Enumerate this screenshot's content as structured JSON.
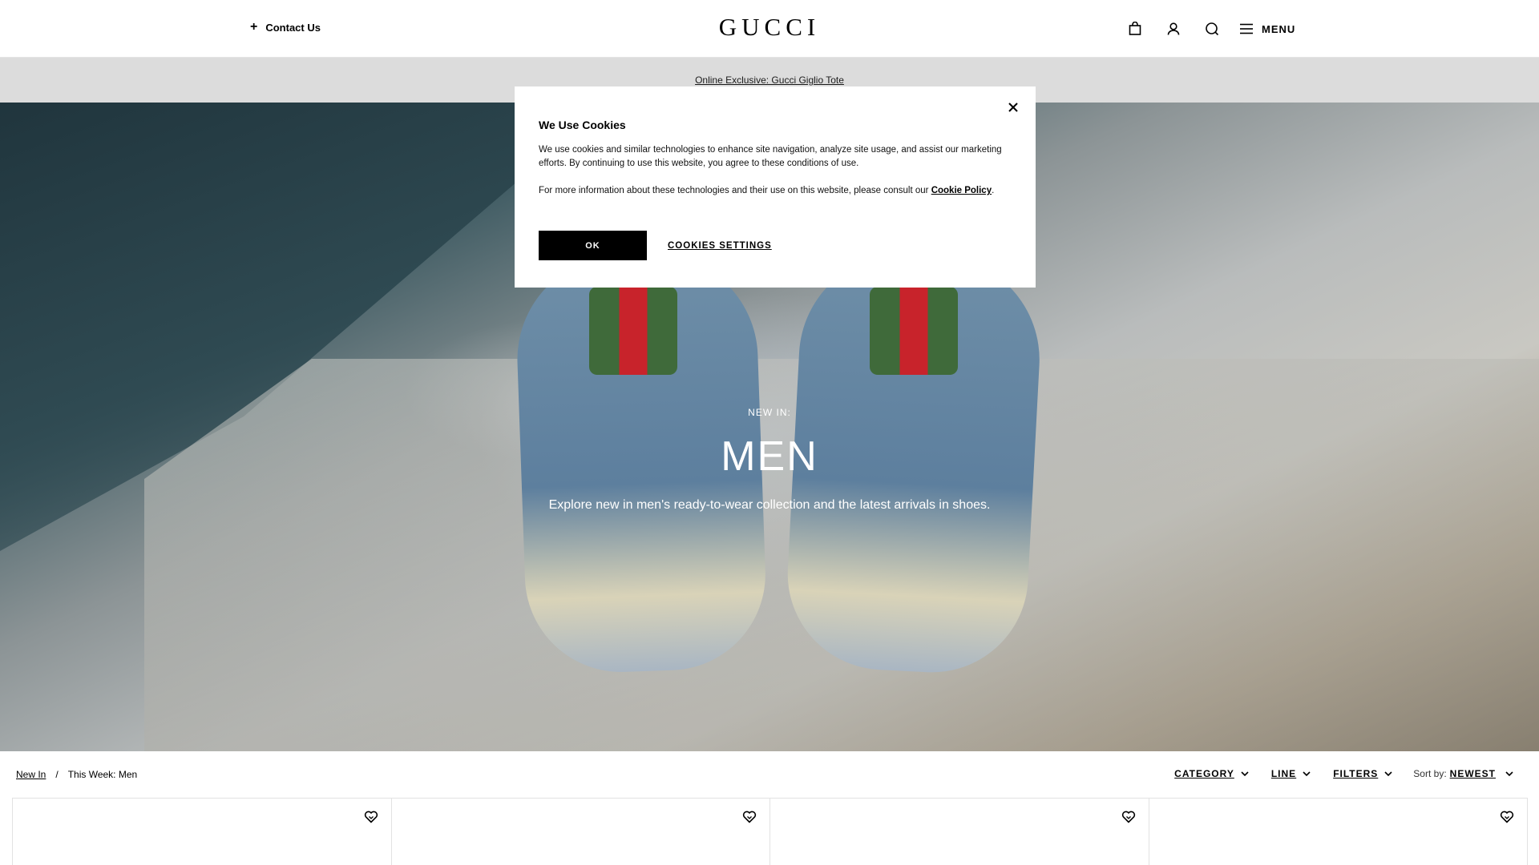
{
  "header": {
    "contact_label": "Contact Us",
    "logo_text": "GUCCI",
    "menu_label": "MENU",
    "icons": [
      "shopping-bag-icon",
      "user-icon",
      "search-icon",
      "hamburger-icon"
    ]
  },
  "promo": {
    "text": "Online Exclusive: Gucci Giglio Tote"
  },
  "hero": {
    "kicker": "NEW IN:",
    "title": "MEN",
    "subtitle": "Explore new in men's ready-to-wear collection and the latest arrivals in shoes."
  },
  "cookie_modal": {
    "title": "We Use Cookies",
    "paragraph_1": "We use cookies and similar technologies to enhance site navigation, analyze site usage, and assist our marketing efforts. By continuing to use this website, you agree to these conditions of use.",
    "paragraph_2_prefix": "For more information about these technologies and their use on this website, please consult our",
    "policy_link": "Cookie Policy",
    "paragraph_2_suffix": ".",
    "ok_label": "OK",
    "settings_label": "COOKIES SETTINGS"
  },
  "toolbar": {
    "breadcrumb": {
      "parent": "New In",
      "separator": "/",
      "current": "This Week: Men"
    },
    "filters": [
      {
        "label": "CATEGORY"
      },
      {
        "label": "LINE"
      },
      {
        "label": "FILTERS"
      }
    ],
    "sort_label": "Sort by:",
    "sort_value": "NEWEST"
  },
  "products": {
    "count_visible": 4
  },
  "colors": {
    "accent": "#000000",
    "promo_bg": "#dcdcdc",
    "background": "#ffffff"
  }
}
